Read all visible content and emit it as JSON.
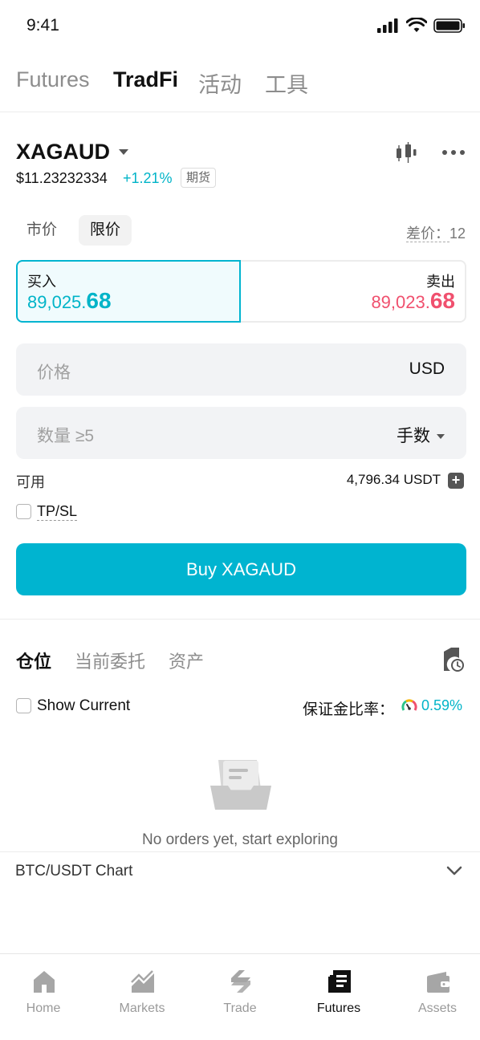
{
  "status": {
    "time": "9:41"
  },
  "top_tabs": [
    {
      "label": "Futures",
      "active": false
    },
    {
      "label": "TradFi",
      "active": true
    },
    {
      "label": "活动",
      "active": false
    },
    {
      "label": "工具",
      "active": false
    }
  ],
  "symbol": {
    "name": "XAGAUD",
    "price": "$11.23232334",
    "change": "+1.21%",
    "badge": "期货"
  },
  "order_types": {
    "market": "市价",
    "limit": "限价",
    "active": "limit"
  },
  "spread": {
    "label": "差价：",
    "value": "12"
  },
  "buy": {
    "label": "买入",
    "price_main": "89,025.",
    "price_big": "68"
  },
  "sell": {
    "label": "卖出",
    "price_main": "89,023.",
    "price_big": "68"
  },
  "price_input": {
    "placeholder": "价格",
    "unit": "USD"
  },
  "qty_input": {
    "placeholder": "数量 ≥5",
    "unit": "手数"
  },
  "available": {
    "label": "可用",
    "value": "4,796.34 USDT"
  },
  "tpsl": {
    "label": "TP/SL"
  },
  "buy_button": {
    "label": "Buy XAGAUD"
  },
  "position_tabs": [
    {
      "label": "仓位",
      "active": true
    },
    {
      "label": "当前委托",
      "active": false
    },
    {
      "label": "资产",
      "active": false
    }
  ],
  "show_current": {
    "label": "Show Current"
  },
  "margin_ratio": {
    "label": "保证金比率：",
    "value": "0.59%"
  },
  "empty": {
    "text": "No orders yet, start exploring"
  },
  "chart_bar": {
    "title": "BTC/USDT  Chart"
  },
  "bottom_nav": [
    {
      "label": "Home",
      "icon": "home-icon",
      "active": false
    },
    {
      "label": "Markets",
      "icon": "markets-icon",
      "active": false
    },
    {
      "label": "Trade",
      "icon": "trade-icon",
      "active": false
    },
    {
      "label": "Futures",
      "icon": "futures-icon",
      "active": true
    },
    {
      "label": "Assets",
      "icon": "assets-icon",
      "active": false
    }
  ],
  "colors": {
    "accent": "#00b4d0",
    "buy_price": "#00b4c8",
    "sell_price": "#f0506e",
    "inactive": "#8d8d8d"
  }
}
